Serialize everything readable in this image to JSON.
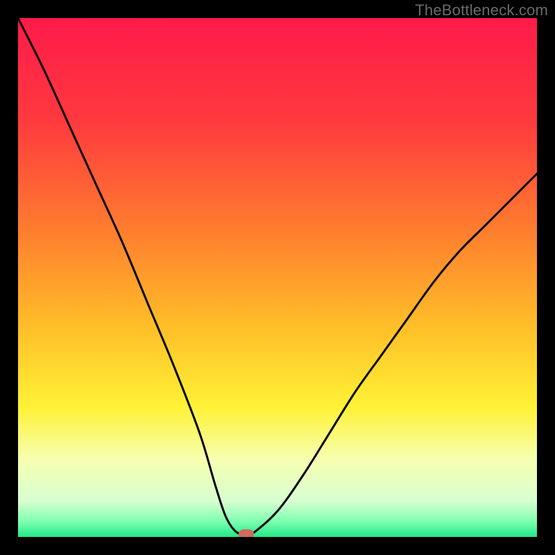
{
  "attribution": "TheBottleneck.com",
  "chart_data": {
    "type": "line",
    "title": "",
    "xlabel": "",
    "ylabel": "",
    "xlim": [
      0,
      100
    ],
    "ylim": [
      0,
      100
    ],
    "series": [
      {
        "name": "bottleneck-curve",
        "x": [
          0,
          5,
          10,
          15,
          20,
          25,
          30,
          35,
          38,
          40,
          42,
          44,
          45,
          50,
          55,
          60,
          65,
          70,
          75,
          80,
          85,
          90,
          95,
          100
        ],
        "y": [
          100,
          90,
          79,
          68,
          57,
          45,
          33,
          20,
          10,
          4,
          1,
          0.5,
          0.5,
          5,
          12,
          20,
          28,
          35,
          42,
          49,
          55,
          60,
          65,
          70
        ]
      }
    ],
    "marker": {
      "x": 44,
      "y": 0.5
    },
    "gradient_stops": [
      {
        "offset": 0.0,
        "color": "#ff1a4a"
      },
      {
        "offset": 0.2,
        "color": "#ff3a3e"
      },
      {
        "offset": 0.4,
        "color": "#ff7a2f"
      },
      {
        "offset": 0.6,
        "color": "#ffc028"
      },
      {
        "offset": 0.75,
        "color": "#fff236"
      },
      {
        "offset": 0.85,
        "color": "#f6ffb0"
      },
      {
        "offset": 0.93,
        "color": "#d8ffd0"
      },
      {
        "offset": 0.97,
        "color": "#7fffb0"
      },
      {
        "offset": 1.0,
        "color": "#1fe989"
      }
    ]
  }
}
